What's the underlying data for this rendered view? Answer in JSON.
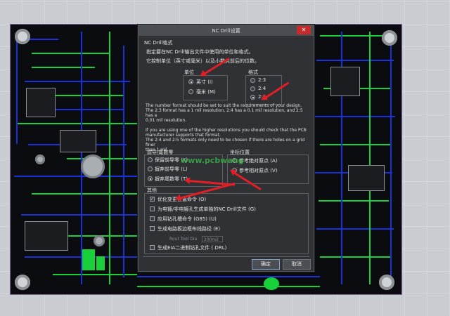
{
  "dialog": {
    "title": "NC Drill设置",
    "close_label": "✕",
    "section_format": "NC Drill格式",
    "intro_line1": "指定要在NC Drill输出文件中使用的单位和格式。",
    "intro_line2": "它控制单位（英寸或毫米）以及小数点前后的位数。",
    "units": {
      "label": "单位",
      "options": [
        {
          "label": "英寸 (I)",
          "selected": true
        },
        {
          "label": "毫米 (M)",
          "selected": false
        }
      ]
    },
    "format": {
      "label": "格式",
      "options": [
        {
          "label": "2:3",
          "selected": false
        },
        {
          "label": "2:4",
          "selected": false
        },
        {
          "label": "2:5",
          "selected": true
        }
      ]
    },
    "note_lines": [
      "The number format should be set to suit the requirements of your design.",
      "The 2:3 format has a 1 mil resolution, 2:4 has a 0.1 mil resolution, and 2:5 has a",
      "0.01 mil resolution.",
      "",
      "If you are using one of the higher resolutions you should check that the PCB",
      "manufacturer supports that format.",
      "The 2:4 and 2:5 formats only need to be chosen if there are holes on a grid finer",
      "than 1 mil."
    ],
    "zeros": {
      "label": "前导/尾数零",
      "options": [
        {
          "label": "保留前导零 (K)",
          "selected": false
        },
        {
          "label": "摒弃前导零 (L)",
          "selected": false
        },
        {
          "label": "摒弃尾数零 (T)",
          "selected": true
        }
      ]
    },
    "coords": {
      "label": "坐标位置",
      "options": [
        {
          "label": "参考绝对原点 (A)",
          "selected": false
        },
        {
          "label": "参考相对原点 (V)",
          "selected": true
        }
      ]
    },
    "other": {
      "label": "其他",
      "checks": [
        {
          "label": "优化变更位置命令 (O)",
          "checked": true
        },
        {
          "label": "为电镀/非电镀孔生成单独的NC Drill文件 (G)",
          "checked": false
        },
        {
          "label": "应用钻孔槽命令 (G85) (U)",
          "checked": false
        },
        {
          "label": "生成电路板边框布线路径 (E)",
          "checked": false
        },
        {
          "label": "生成EIA二进制钻孔文件 (.DRL)",
          "checked": false
        }
      ],
      "rout_tool_label": "Rout Tool Dia",
      "rout_tool_value": "200mil"
    },
    "ok_label": "确定",
    "cancel_label": "取消"
  },
  "watermark_text": "www.pcbwang",
  "colors": {
    "arrow": "#e21f26",
    "board": "#0b0c10",
    "trace_green": "#18d13a",
    "trace_blue": "#1b33d6",
    "dialog_bg": "#2f3134",
    "close": "#c62a2a"
  }
}
